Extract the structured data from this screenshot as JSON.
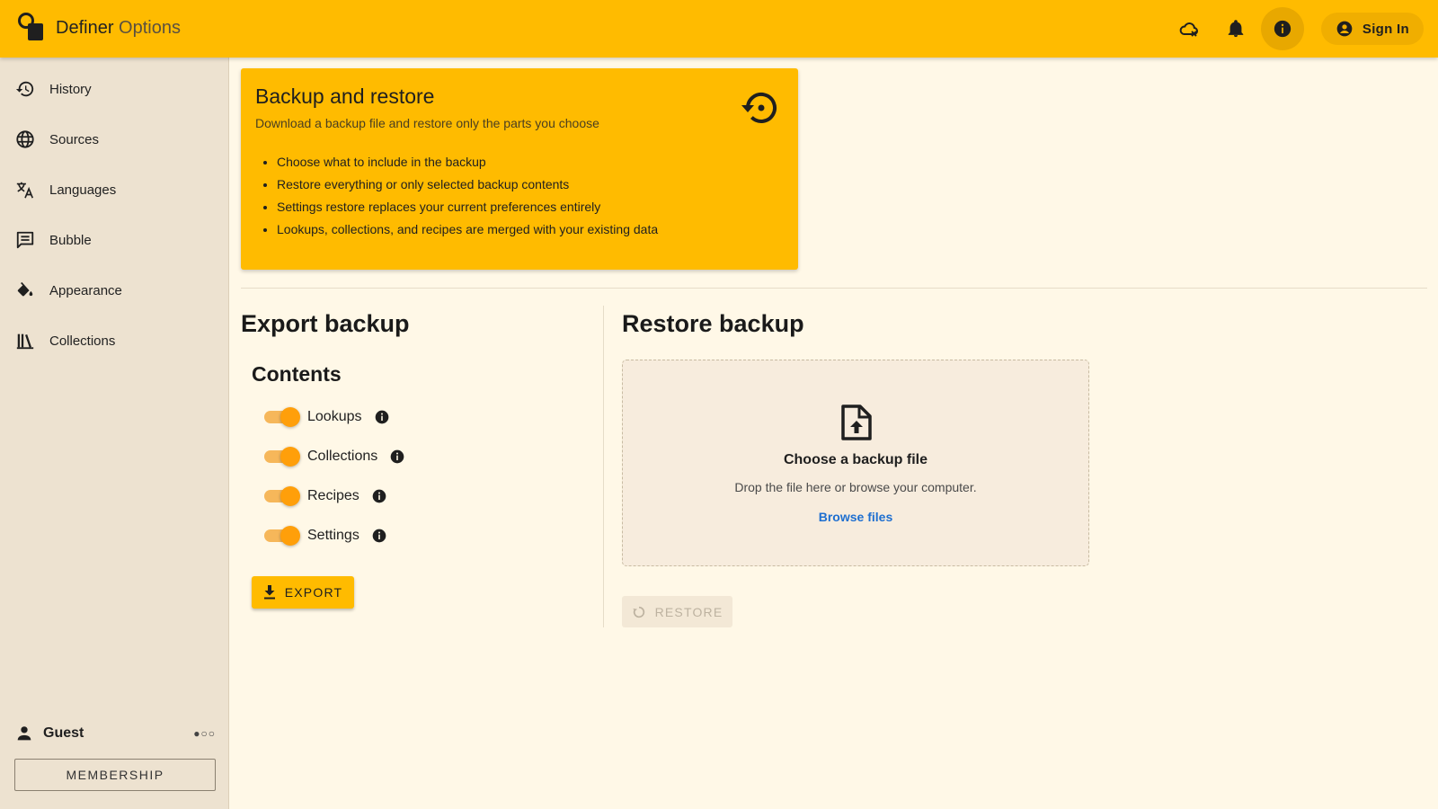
{
  "app": {
    "title_main": "Definer",
    "title_sub": "Options"
  },
  "header": {
    "sign_in_label": "Sign In"
  },
  "sidebar": {
    "items": [
      {
        "label": "History",
        "icon": "history-icon"
      },
      {
        "label": "Sources",
        "icon": "globe-icon"
      },
      {
        "label": "Languages",
        "icon": "translate-icon"
      },
      {
        "label": "Bubble",
        "icon": "comment-icon"
      },
      {
        "label": "Appearance",
        "icon": "paint-bucket-icon"
      },
      {
        "label": "Collections",
        "icon": "library-icon"
      }
    ],
    "user_label": "Guest",
    "membership_label": "MEMBERSHIP"
  },
  "banner": {
    "title": "Backup and restore",
    "subtitle": "Download a backup file and restore only the parts you choose",
    "bullets": [
      "Choose what to include in the backup",
      "Restore everything or only selected backup contents",
      "Settings restore replaces your current preferences entirely",
      "Lookups, collections, and recipes are merged with your existing data"
    ]
  },
  "export": {
    "title": "Export backup",
    "contents_title": "Contents",
    "toggles": [
      {
        "label": "Lookups",
        "on": true
      },
      {
        "label": "Collections",
        "on": true
      },
      {
        "label": "Recipes",
        "on": true
      },
      {
        "label": "Settings",
        "on": true
      }
    ],
    "button_label": "EXPORT"
  },
  "restore": {
    "title": "Restore backup",
    "drop_title": "Choose a backup file",
    "drop_subtitle": "Drop the file here or browse your computer.",
    "browse_label": "Browse files",
    "button_label": "RESTORE"
  },
  "colors": {
    "accent": "#ffbb00",
    "background": "#fff8e7",
    "sidebar": "#ede2d0",
    "link": "#1e6fd0",
    "toggle": "#ff9f0a"
  }
}
